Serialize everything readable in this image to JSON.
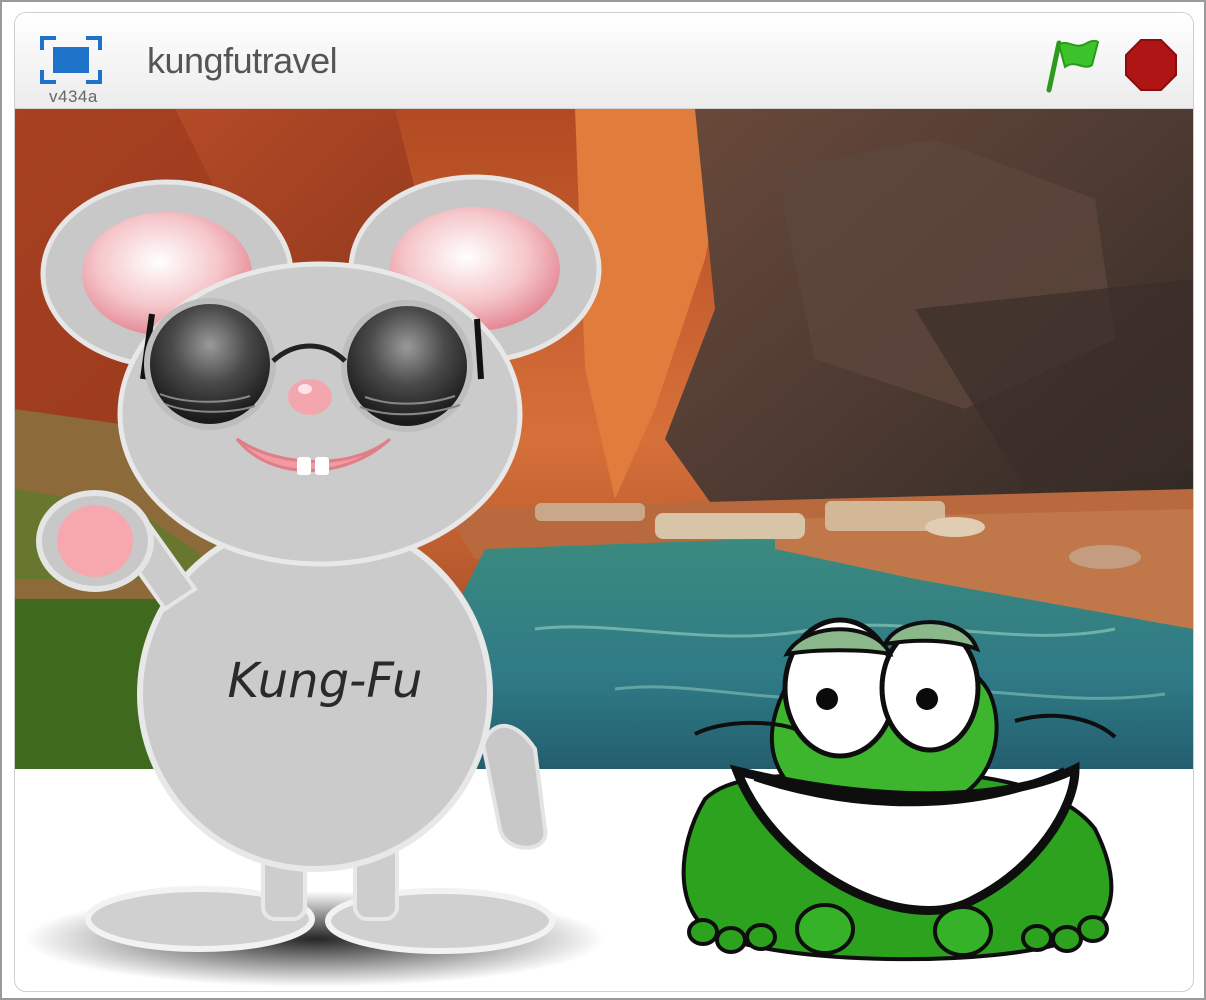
{
  "player": {
    "version": "v434a",
    "title": "kungfutravel"
  },
  "controls": {
    "fullscreen_icon": "fullscreen-icon",
    "green_flag_icon": "green-flag-icon",
    "stop_icon": "stop-sign-icon",
    "flag_color": "#3cc22a",
    "stop_color": "#b01515"
  },
  "stage": {
    "backdrop": "canyon-river",
    "sprites": [
      {
        "name": "mouse",
        "shirt_text": "Kung-Fu"
      },
      {
        "name": "frog"
      }
    ]
  }
}
